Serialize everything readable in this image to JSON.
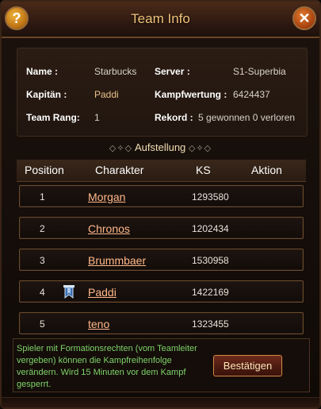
{
  "window": {
    "title": "Team Info",
    "help_icon": "question-mark-icon",
    "close_icon": "close-x-icon"
  },
  "info": {
    "name_label": "Name :",
    "name_value": "Starbucks",
    "server_label": "Server :",
    "server_value": "S1-Superbia",
    "captain_label": "Kapitän :",
    "captain_value": "Paddi",
    "combat_label": "Kampfwertung :",
    "combat_value": "6424437",
    "rank_label": "Team Rang:",
    "rank_value": "1",
    "record_label": "Rekord :",
    "record_value": "5 gewonnen 0 verloren"
  },
  "lineup": {
    "title": "Aufstellung",
    "columns": [
      "Position",
      "Charakter",
      "KS",
      "Aktion"
    ],
    "rows": [
      {
        "position": "1",
        "name": "Morgan",
        "ks": "1293580",
        "captain": false
      },
      {
        "position": "2",
        "name": "Chronos",
        "ks": "1202434",
        "captain": false
      },
      {
        "position": "3",
        "name": "Brummbaer",
        "ks": "1530958",
        "captain": false
      },
      {
        "position": "4",
        "name": "Paddi",
        "ks": "1422169",
        "captain": true
      },
      {
        "position": "5",
        "name": "teno",
        "ks": "1323455",
        "captain": false
      }
    ]
  },
  "notice": {
    "text": "Spieler mit Formationsrechten (vom Teamleiter vergeben) können die Kampfreihenfolge verändern. Wird 15 Minuten vor dem Kampf gesperrt.",
    "confirm_label": "Bestätigen"
  },
  "colors": {
    "title": "#f0c27a",
    "name_link": "#ffb88a",
    "notice_text": "#7fd36a"
  }
}
